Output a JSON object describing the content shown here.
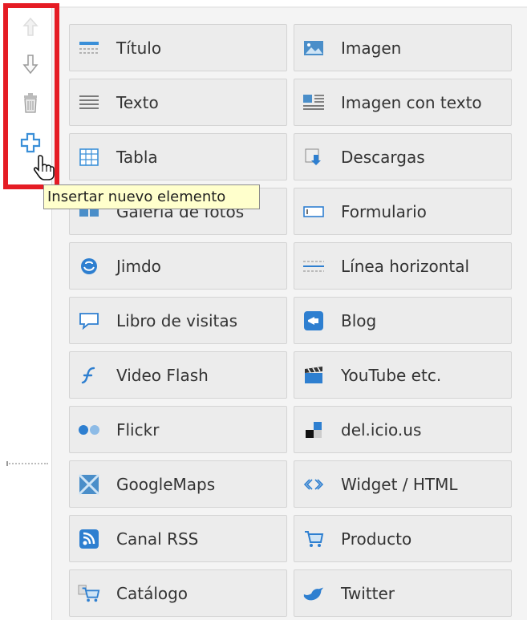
{
  "toolbar": {
    "tooltip": "Insertar nuevo elemento"
  },
  "colors": {
    "highlight": "#e51c24",
    "tooltip_bg": "#ffffcc",
    "plus_icon": "#3a8fd8"
  },
  "elements": [
    {
      "label": "Título",
      "icon": "title-icon"
    },
    {
      "label": "Imagen",
      "icon": "image-icon"
    },
    {
      "label": "Texto",
      "icon": "text-icon"
    },
    {
      "label": "Imagen con texto",
      "icon": "image-text-icon"
    },
    {
      "label": "Tabla",
      "icon": "table-icon"
    },
    {
      "label": "Descargas",
      "icon": "download-icon"
    },
    {
      "label": "Galería de fotos",
      "icon": "gallery-icon"
    },
    {
      "label": "Formulario",
      "icon": "form-icon"
    },
    {
      "label": "Jimdo",
      "icon": "jimdo-icon"
    },
    {
      "label": "Línea horizontal",
      "icon": "horizontal-line-icon"
    },
    {
      "label": "Libro de visitas",
      "icon": "guestbook-icon"
    },
    {
      "label": "Blog",
      "icon": "blog-icon"
    },
    {
      "label": "Video Flash",
      "icon": "flash-icon"
    },
    {
      "label": "YouTube etc.",
      "icon": "youtube-icon"
    },
    {
      "label": "Flickr",
      "icon": "flickr-icon"
    },
    {
      "label": "del.icio.us",
      "icon": "delicious-icon"
    },
    {
      "label": "GoogleMaps",
      "icon": "map-icon"
    },
    {
      "label": "Widget / HTML",
      "icon": "code-icon"
    },
    {
      "label": "Canal RSS",
      "icon": "rss-icon"
    },
    {
      "label": "Producto",
      "icon": "cart-icon"
    },
    {
      "label": "Catálogo",
      "icon": "catalog-icon"
    },
    {
      "label": "Twitter",
      "icon": "twitter-icon"
    }
  ]
}
